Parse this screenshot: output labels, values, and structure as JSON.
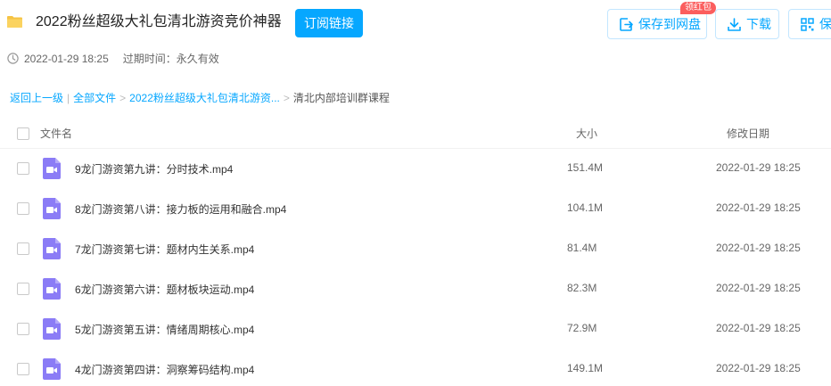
{
  "header": {
    "title": "2022粉丝超级大礼包清北游资竞价神器",
    "subscribe_label": "订阅链接",
    "save_label": "保存到网盘",
    "save_badge": "领红包",
    "download_label": "下载",
    "more_label": "保存"
  },
  "meta": {
    "created": "2022-01-29 18:25",
    "expire": "过期时间：永久有效"
  },
  "breadcrumb": {
    "back": "返回上一级",
    "all_files": "全部文件",
    "parent": "2022粉丝超级大礼包清北游资...",
    "current": "清北内部培训群课程",
    "separator": "|",
    "arrow": ">"
  },
  "table": {
    "headers": {
      "name": "文件名",
      "size": "大小",
      "date": "修改日期"
    },
    "rows": [
      {
        "name": "9龙门游资第九讲：分时技术.mp4",
        "size": "151.4M",
        "date": "2022-01-29 18:25"
      },
      {
        "name": "8龙门游资第八讲：接力板的运用和融合.mp4",
        "size": "104.1M",
        "date": "2022-01-29 18:25"
      },
      {
        "name": "7龙门游资第七讲：题材内生关系.mp4",
        "size": "81.4M",
        "date": "2022-01-29 18:25"
      },
      {
        "name": "6龙门游资第六讲：题材板块运动.mp4",
        "size": "82.3M",
        "date": "2022-01-29 18:25"
      },
      {
        "name": "5龙门游资第五讲：情绪周期核心.mp4",
        "size": "72.9M",
        "date": "2022-01-29 18:25"
      },
      {
        "name": "4龙门游资第四讲：洞察筹码结构.mp4",
        "size": "149.1M",
        "date": "2022-01-29 18:25"
      }
    ]
  },
  "icons": {
    "folder": "folder-icon",
    "clock": "clock-icon",
    "save": "save-to-cloud-icon",
    "download": "download-icon",
    "more": "qr-save-icon",
    "file": "video-file-icon"
  },
  "colors": {
    "accent": "#06a7ff",
    "badge": "#fb5e5e",
    "folder": "#f6c343",
    "video_file": "#8b7cf6"
  }
}
